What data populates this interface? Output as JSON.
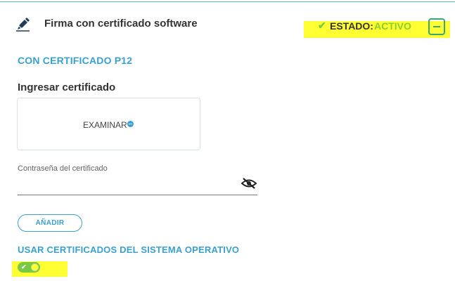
{
  "header": {
    "icon": "pen-signature-icon",
    "title": "Firma con certificado software",
    "status_check": "✔",
    "status_label": "ESTADO:",
    "status_value": "ACTIVO",
    "collapse_icon": "minus-square-icon"
  },
  "p12": {
    "section_title": "CON CERTIFICADO P12",
    "input_title": "Ingresar certificado",
    "browse_label": "EXAMINAR",
    "browse_icon": "plus-circle-icon",
    "password_label": "Contraseña del certificado",
    "password_value": "",
    "password_toggle_icon": "eye-slash-icon",
    "add_label": "AÑADIR"
  },
  "os_certs": {
    "section_title": "USAR CERTIFICADOS DEL SISTEMA OPERATIVO",
    "toggle_on": true,
    "toggle_check": "✔"
  },
  "colors": {
    "accent": "#3aa0d0",
    "active": "#7ac943",
    "highlight": "#ffff33",
    "collapse": "#3aa776"
  }
}
